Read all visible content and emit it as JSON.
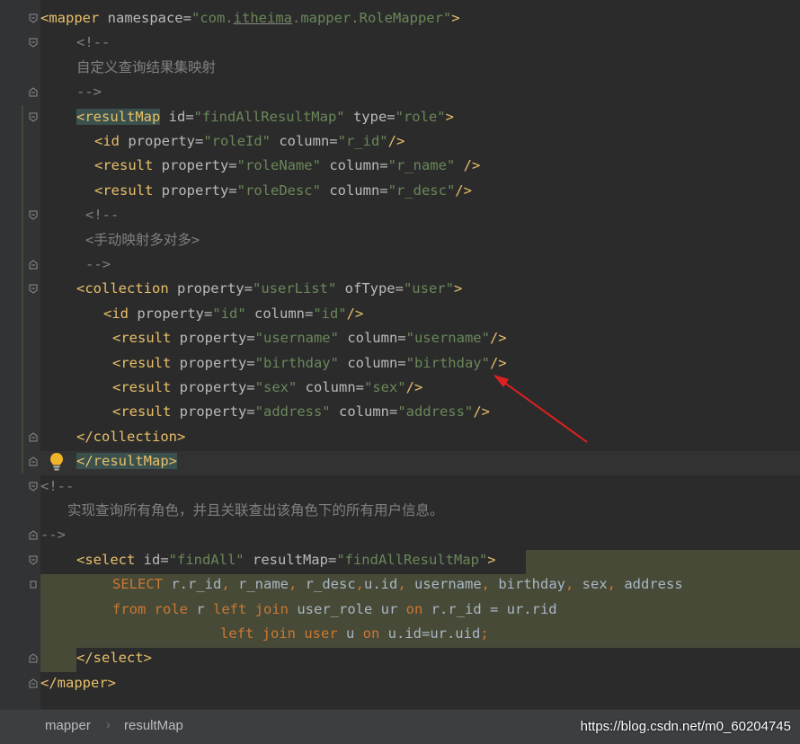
{
  "lines": [
    [
      {
        "t": "<mapper ",
        "c": "t"
      },
      {
        "t": "namespace=",
        "c": "a"
      },
      {
        "t": "\"com.",
        "c": "v"
      },
      {
        "t": "itheima",
        "c": "v u"
      },
      {
        "t": ".mapper.RoleMapper\"",
        "c": "v"
      },
      {
        "t": ">",
        "c": "t"
      }
    ],
    [
      {
        "t": "<!--",
        "c": "c"
      }
    ],
    [
      {
        "t": "自定义查询结果集映射",
        "c": "c"
      }
    ],
    [
      {
        "t": "-->",
        "c": "c"
      }
    ],
    [
      {
        "t": "<resultMap",
        "c": "t hl"
      },
      {
        "t": " id=",
        "c": "a"
      },
      {
        "t": "\"findAllResultMap\"",
        "c": "v"
      },
      {
        "t": " type=",
        "c": "a"
      },
      {
        "t": "\"role\"",
        "c": "v"
      },
      {
        "t": ">",
        "c": "t"
      }
    ],
    [
      {
        "t": "<id ",
        "c": "t"
      },
      {
        "t": "property=",
        "c": "a"
      },
      {
        "t": "\"roleId\"",
        "c": "v"
      },
      {
        "t": " column=",
        "c": "a"
      },
      {
        "t": "\"r_id\"",
        "c": "v"
      },
      {
        "t": "/>",
        "c": "t"
      }
    ],
    [
      {
        "t": "<result ",
        "c": "t"
      },
      {
        "t": "property=",
        "c": "a"
      },
      {
        "t": "\"roleName\"",
        "c": "v"
      },
      {
        "t": " column=",
        "c": "a"
      },
      {
        "t": "\"r_name\"",
        "c": "v"
      },
      {
        "t": " />",
        "c": "t"
      }
    ],
    [
      {
        "t": "<result ",
        "c": "t"
      },
      {
        "t": "property=",
        "c": "a"
      },
      {
        "t": "\"roleDesc\"",
        "c": "v"
      },
      {
        "t": " column=",
        "c": "a"
      },
      {
        "t": "\"r_desc\"",
        "c": "v"
      },
      {
        "t": "/>",
        "c": "t"
      }
    ],
    [
      {
        "t": "<!--",
        "c": "c"
      }
    ],
    [
      {
        "t": "<手动映射多对多>",
        "c": "c"
      }
    ],
    [
      {
        "t": "-->",
        "c": "c"
      }
    ],
    [
      {
        "t": "<collection ",
        "c": "t"
      },
      {
        "t": "property=",
        "c": "a"
      },
      {
        "t": "\"userList\"",
        "c": "v"
      },
      {
        "t": " ofType=",
        "c": "a"
      },
      {
        "t": "\"user\"",
        "c": "v"
      },
      {
        "t": ">",
        "c": "t"
      }
    ],
    [
      {
        "t": "<id ",
        "c": "t"
      },
      {
        "t": "property=",
        "c": "a"
      },
      {
        "t": "\"id\"",
        "c": "v"
      },
      {
        "t": " column=",
        "c": "a"
      },
      {
        "t": "\"id\"",
        "c": "v"
      },
      {
        "t": "/>",
        "c": "t"
      }
    ],
    [
      {
        "t": "<result ",
        "c": "t"
      },
      {
        "t": "property=",
        "c": "a"
      },
      {
        "t": "\"username\"",
        "c": "v"
      },
      {
        "t": " column=",
        "c": "a"
      },
      {
        "t": "\"username\"",
        "c": "v"
      },
      {
        "t": "/>",
        "c": "t"
      }
    ],
    [
      {
        "t": "<result ",
        "c": "t"
      },
      {
        "t": "property=",
        "c": "a"
      },
      {
        "t": "\"birthday\"",
        "c": "v"
      },
      {
        "t": " column=",
        "c": "a"
      },
      {
        "t": "\"birthday\"",
        "c": "v"
      },
      {
        "t": "/>",
        "c": "t"
      }
    ],
    [
      {
        "t": "<result ",
        "c": "t"
      },
      {
        "t": "property=",
        "c": "a"
      },
      {
        "t": "\"sex\"",
        "c": "v"
      },
      {
        "t": " column=",
        "c": "a"
      },
      {
        "t": "\"sex\"",
        "c": "v"
      },
      {
        "t": "/>",
        "c": "t"
      }
    ],
    [
      {
        "t": "<result ",
        "c": "t"
      },
      {
        "t": "property=",
        "c": "a"
      },
      {
        "t": "\"address\"",
        "c": "v"
      },
      {
        "t": " column=",
        "c": "a"
      },
      {
        "t": "\"address\"",
        "c": "v"
      },
      {
        "t": "/>",
        "c": "t"
      }
    ],
    [
      {
        "t": "</collection>",
        "c": "t"
      }
    ],
    [
      {
        "t": "</resultMap>",
        "c": "t hl"
      }
    ],
    [
      {
        "t": "<!--",
        "c": "c"
      }
    ],
    [
      {
        "t": "实现查询所有角色，并且关联查出该角色下的所有用户信息。",
        "c": "c"
      }
    ],
    [
      {
        "t": "-->",
        "c": "c"
      }
    ],
    [
      {
        "t": "<select ",
        "c": "t"
      },
      {
        "t": "id=",
        "c": "a"
      },
      {
        "t": "\"findAll\"",
        "c": "v"
      },
      {
        "t": " resultMap=",
        "c": "a"
      },
      {
        "t": "\"findAllResultMap\"",
        "c": "v"
      },
      {
        "t": ">",
        "c": "t"
      }
    ],
    [
      {
        "t": "SELECT ",
        "c": "k"
      },
      {
        "t": "r.r_id",
        "c": "p"
      },
      {
        "t": ", ",
        "c": "k"
      },
      {
        "t": "r_name",
        "c": "p"
      },
      {
        "t": ", ",
        "c": "k"
      },
      {
        "t": "r_desc",
        "c": "p"
      },
      {
        "t": ",",
        "c": "k"
      },
      {
        "t": "u.id",
        "c": "p"
      },
      {
        "t": ", ",
        "c": "k"
      },
      {
        "t": "username",
        "c": "p"
      },
      {
        "t": ", ",
        "c": "k"
      },
      {
        "t": "birthday",
        "c": "p"
      },
      {
        "t": ", ",
        "c": "k"
      },
      {
        "t": "sex",
        "c": "p"
      },
      {
        "t": ", ",
        "c": "k"
      },
      {
        "t": "address",
        "c": "p"
      }
    ],
    [
      {
        "t": "from role ",
        "c": "k"
      },
      {
        "t": "r ",
        "c": "p"
      },
      {
        "t": "left join ",
        "c": "k"
      },
      {
        "t": "user_role ur ",
        "c": "p"
      },
      {
        "t": "on ",
        "c": "k"
      },
      {
        "t": "r.r_id = ur.rid",
        "c": "p"
      }
    ],
    [
      {
        "t": "left join user ",
        "c": "k"
      },
      {
        "t": "u ",
        "c": "p"
      },
      {
        "t": "on ",
        "c": "k"
      },
      {
        "t": "u.id=ur.uid",
        "c": "p"
      },
      {
        "t": ";",
        "c": "k"
      }
    ],
    [
      {
        "t": "</select>",
        "c": "t"
      }
    ],
    [
      {
        "t": "</mapper>",
        "c": "t"
      }
    ]
  ],
  "breadcrumbs": [
    "mapper",
    "resultMap"
  ],
  "breadcrumb_separator": "›",
  "watermark": "https://blog.csdn.net/m0_60204745",
  "colors": {
    "tag": "#e8bf6a",
    "attr": "#bababa",
    "value": "#6a8759",
    "comment": "#808080",
    "keyword": "#cc7832",
    "background": "#2b2b2b",
    "annotation_arrow": "#e02020"
  }
}
